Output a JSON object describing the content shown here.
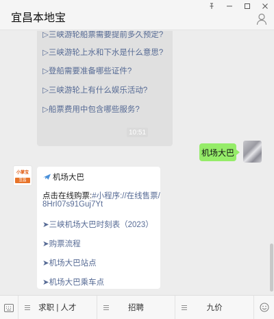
{
  "window": {
    "title": "宜昌本地宝"
  },
  "faq": {
    "items": [
      "▷三峡游轮船票需要提前多久预定?",
      "▷三峡游轮上水和下水是什么意思?",
      "▷登船需要准备哪些证件?",
      "▷三峡游轮上有什么娱乐活动?",
      "▷船票费用中包含哪些服务?"
    ]
  },
  "timestamp": "10:51",
  "user_message": "机场大巴",
  "bot_avatar": {
    "line1": "小掌宝",
    "line2": "宜昌"
  },
  "bot_message": {
    "header": "机场大巴",
    "buy_prefix": "点击在线购票:",
    "buy_link_1": "#小程序://在线售票/",
    "buy_link_2": "8HrI07s91Guj7Yt",
    "links": [
      "➤三峡机场大巴时刻表（2023）",
      "➤购票流程",
      "➤机场大巴站点",
      "➤机场大巴乘车点"
    ]
  },
  "bottom_menu": [
    "求职 | 人才",
    "招聘",
    "九价"
  ],
  "colors": {
    "link": "#576b95",
    "my_bubble": "#95ec69",
    "chat_bg": "#ededed"
  }
}
